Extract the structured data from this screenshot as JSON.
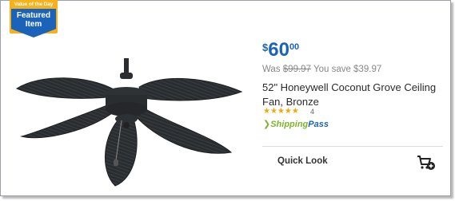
{
  "badge": {
    "top": "Value of the Day",
    "line1": "Featured",
    "line2": "Item"
  },
  "product": {
    "price_symbol": "$",
    "price_dollars": "60",
    "price_cents": "00",
    "was_label": "Was",
    "was_price": "$99.97",
    "save_text": "You save $39.97",
    "title": "52\" Honeywell Coconut Grove Ceiling Fan, Bronze",
    "rating": 4,
    "rating_count": "4",
    "stars_text": "★★★★★",
    "shipping_chevron": "❯",
    "shipping_word": "Shipping",
    "pass_word": "Pass"
  },
  "actions": {
    "quick_look": "Quick Look",
    "cart_icon": "add-to-cart-icon"
  },
  "colors": {
    "accent": "#1a63b8",
    "badge": "#f7b11b",
    "shipping": "#7cb52a",
    "stars": "#f2a900"
  }
}
